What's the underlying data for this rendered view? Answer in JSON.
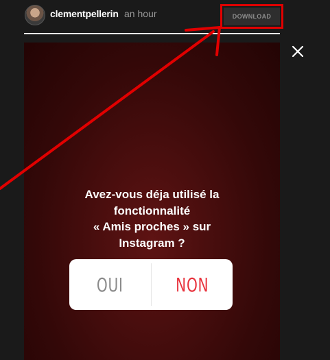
{
  "header": {
    "username": "clementpellerin",
    "timestamp": "an hour",
    "download_label": "DOWNLOAD"
  },
  "icons": {
    "avatar": "profile-photo",
    "close": "close-icon"
  },
  "story": {
    "question_lines": [
      "Avez-vous déja utilisé la",
      "fonctionnalité",
      "« Amis proches » sur",
      "Instagram ?"
    ],
    "poll": {
      "yes_label": "OUI",
      "no_label": "NON"
    },
    "progress": 1.0
  },
  "colors": {
    "annotation": "#e10000",
    "poll_no": "#e8323c",
    "poll_yes": "#8a8a8a",
    "story_background": "#4a0e0e"
  }
}
